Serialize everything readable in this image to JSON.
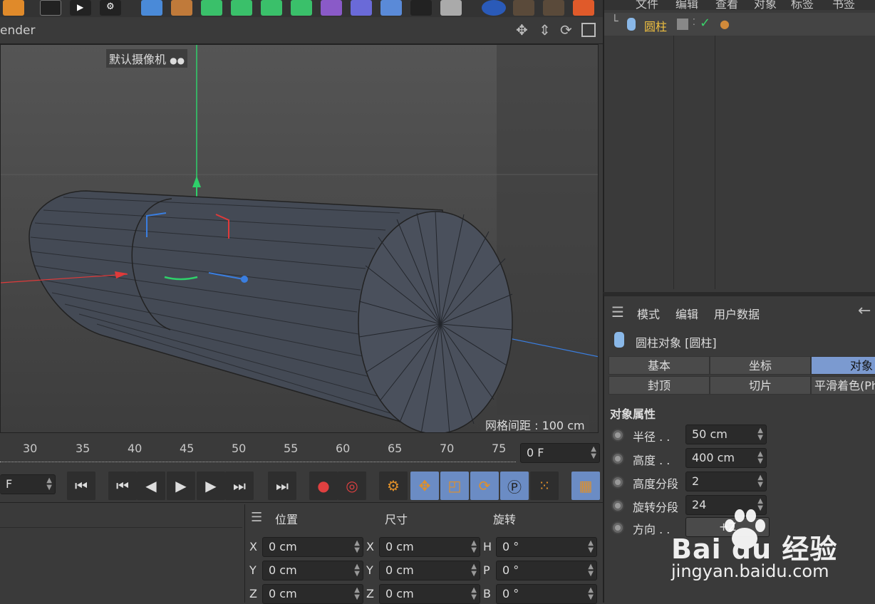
{
  "viewport": {
    "title": "ender",
    "camera_label": "默认摄像机",
    "grid_label": "网格间距 : 100 cm"
  },
  "timeline": {
    "ticks": [
      "30",
      "35",
      "40",
      "45",
      "50",
      "55",
      "60",
      "65",
      "70",
      "75"
    ],
    "current_frame": "0 F",
    "start_frame": "F"
  },
  "coords": {
    "headers": {
      "position": "位置",
      "size": "尺寸",
      "rotation": "旋转"
    },
    "rows": [
      {
        "axis_pos": "X",
        "pos": "0 cm",
        "axis_size": "X",
        "size": "0 cm",
        "axis_rot": "H",
        "rot": "0 °"
      },
      {
        "axis_pos": "Y",
        "pos": "0 cm",
        "axis_size": "Y",
        "size": "0 cm",
        "axis_rot": "P",
        "rot": "0 °"
      },
      {
        "axis_pos": "Z",
        "pos": "0 cm",
        "axis_size": "Z",
        "size": "0 cm",
        "axis_rot": "B",
        "rot": "0 °"
      }
    ]
  },
  "object_manager": {
    "menu": [
      "文件",
      "编辑",
      "查看",
      "对象",
      "标签",
      "书签"
    ],
    "object_name": "圆柱"
  },
  "attributes": {
    "menu": [
      "模式",
      "编辑",
      "用户数据"
    ],
    "object_title": "圆柱对象 [圆柱]",
    "tabs_row1": [
      "基本",
      "坐标",
      "对象"
    ],
    "tabs_row2": [
      "封顶",
      "切片",
      "平滑着色(Ph"
    ],
    "section_title": "对象属性",
    "params": [
      {
        "label": "半径 . .",
        "value": "50 cm"
      },
      {
        "label": "高度 . .",
        "value": "400 cm"
      },
      {
        "label": "高度分段",
        "value": "2"
      },
      {
        "label": "旋转分段",
        "value": "24"
      },
      {
        "label": "方向 . .",
        "value": "+Z"
      }
    ]
  },
  "watermark": {
    "brand": "Bai du 经验",
    "url": "jingyan.baidu.com"
  },
  "colors": {
    "accent": "#7b9ad0",
    "axis_x": "#e03a3a",
    "axis_y": "#2fd06a",
    "axis_z": "#3a7ee0",
    "object_label": "#f0c040"
  }
}
